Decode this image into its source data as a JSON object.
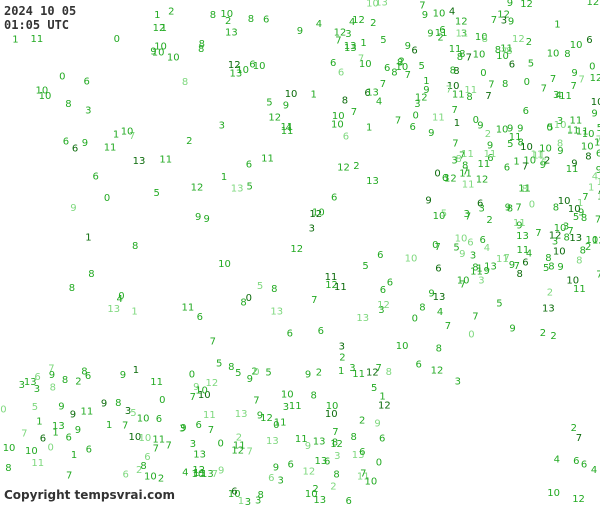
{
  "header": {
    "date": "2024 10 05",
    "time": "01:05 UTC"
  },
  "footer": {
    "copyright": "Copyright tempsvrai.com"
  },
  "legend_colors": {
    "station_value": "#22aa22",
    "station_value_light": "#7ed87e",
    "station_value_dark": "#0b6b0b",
    "label_text": "#333333"
  },
  "station_values": [
    "6",
    "7",
    "8",
    "9",
    "10",
    "11",
    "12",
    "0",
    "1",
    "2",
    "3",
    "4",
    "5",
    "6",
    "7",
    "8",
    "9",
    "10",
    "11",
    "13"
  ]
}
